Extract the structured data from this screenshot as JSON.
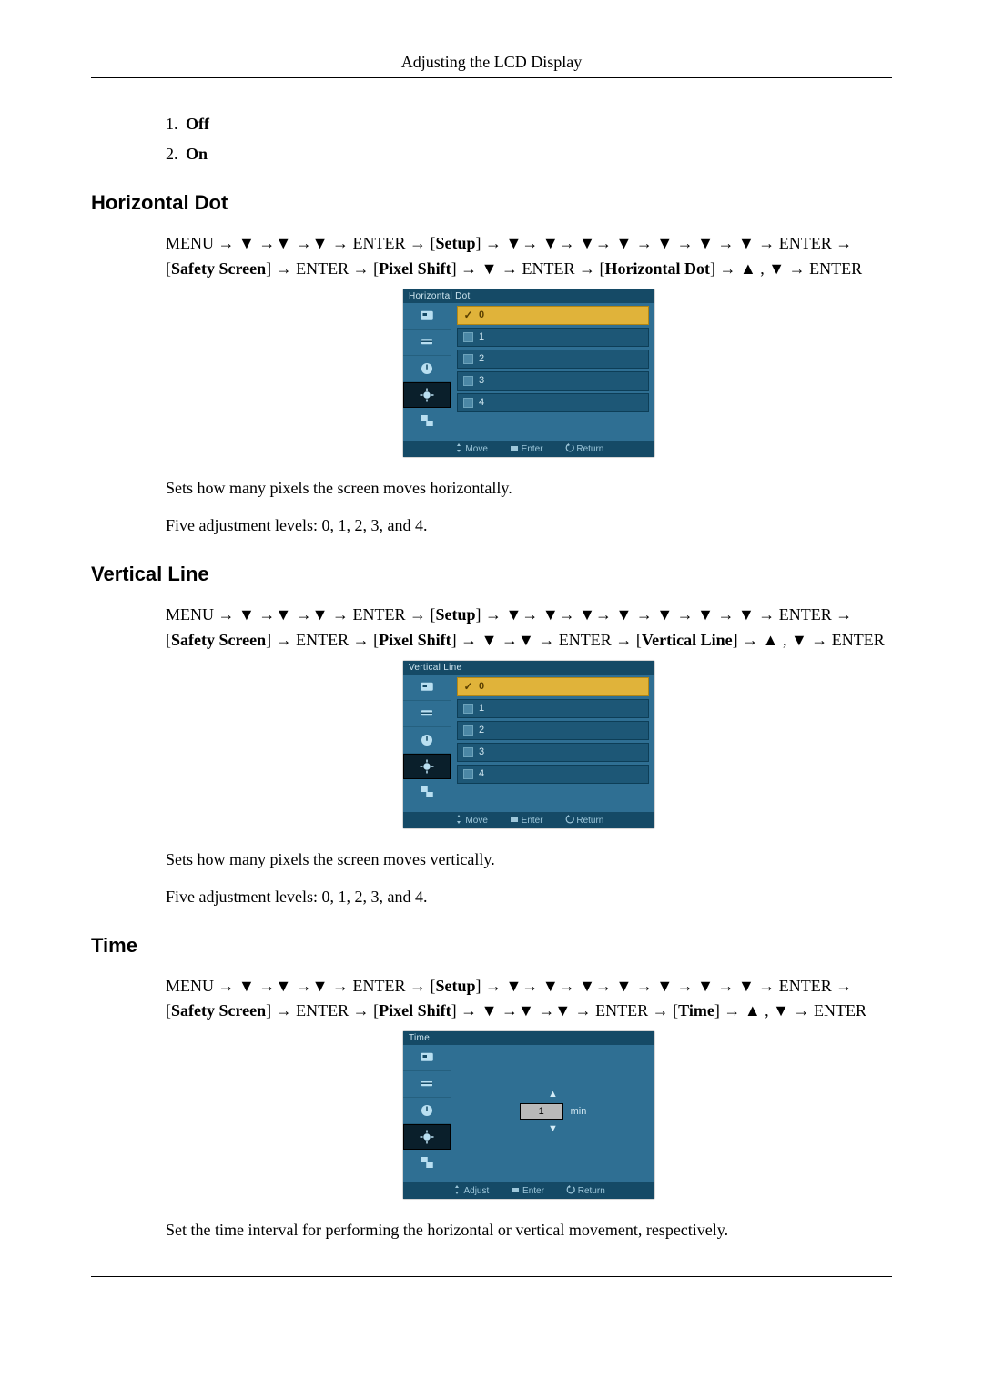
{
  "header": {
    "title": "Adjusting the LCD Display"
  },
  "offon": {
    "items": [
      {
        "num": "1.",
        "label": "Off"
      },
      {
        "num": "2.",
        "label": "On"
      }
    ]
  },
  "glyph": {
    "down": "▼",
    "up": "▲",
    "arrow": "→",
    "check": "✓"
  },
  "nav_common": {
    "menu": "MENU",
    "enter": "ENTER",
    "setup": "Setup",
    "safety_screen": "Safety Screen",
    "pixel_shift": "Pixel Shift"
  },
  "sections": {
    "hdot": {
      "heading": "Horizontal Dot",
      "label": "Horizontal Dot",
      "desc1": "Sets how many pixels the screen moves horizontally.",
      "desc2": "Five adjustment levels: 0, 1, 2, 3, and 4."
    },
    "vline": {
      "heading": "Vertical Line",
      "label": "Vertical Line",
      "desc1": "Sets how many pixels the screen moves vertically.",
      "desc2": "Five adjustment levels: 0, 1, 2, 3, and 4."
    },
    "time": {
      "heading": "Time",
      "label": "Time",
      "desc1": "Set the time interval for performing the horizontal or vertical movement, respectively."
    }
  },
  "osd": {
    "options": [
      "0",
      "1",
      "2",
      "3",
      "4"
    ],
    "selected_index": 0,
    "footer_list": {
      "move": "Move",
      "enter": "Enter",
      "return": "Return"
    },
    "footer_adjust": {
      "adjust": "Adjust",
      "enter": "Enter",
      "return": "Return"
    },
    "time_value": "1",
    "time_unit": "min"
  }
}
